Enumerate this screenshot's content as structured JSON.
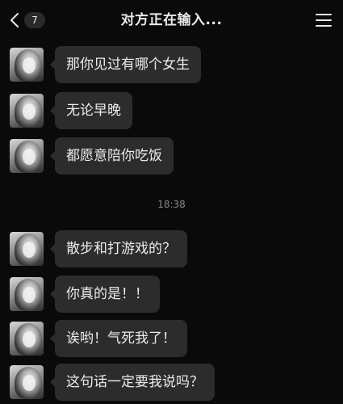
{
  "header": {
    "unread_count": "7",
    "title": "对方正在输入..."
  },
  "icons": {
    "back": "chevron-left-icon",
    "more": "menu-icon"
  },
  "timestamp": "18:38",
  "messages": [
    {
      "text": "那你见过有哪个女生"
    },
    {
      "text": "无论早晚"
    },
    {
      "text": "都愿意陪你吃饭"
    },
    {
      "text": "散步和打游戏的？"
    },
    {
      "text": "你真的是！！"
    },
    {
      "text": "诶哟！气死我了！"
    },
    {
      "text": "这句话一定要我说吗？"
    }
  ]
}
